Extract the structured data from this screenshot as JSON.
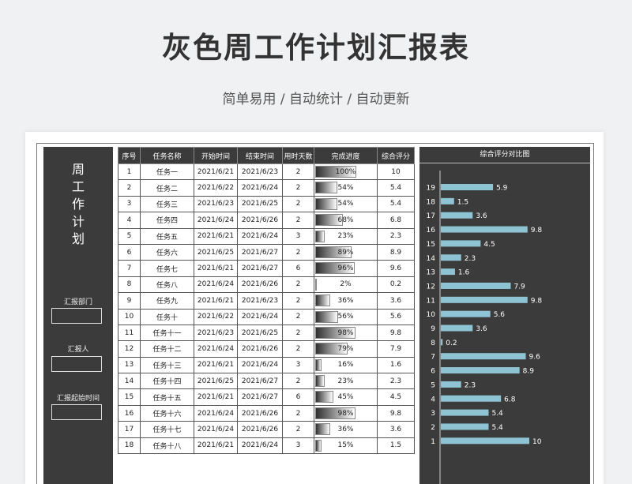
{
  "header": {
    "title": "灰色周工作计划汇报表",
    "subtitle": "简单易用 / 自动统计 / 自动更新"
  },
  "sidebar": {
    "vertical_title": [
      "周",
      "工",
      "作",
      "计",
      "划"
    ],
    "fields": [
      {
        "label": "汇报部门",
        "value": ""
      },
      {
        "label": "汇报人",
        "value": ""
      },
      {
        "label": "汇报起始时间",
        "value": ""
      }
    ]
  },
  "table": {
    "columns": [
      "序号",
      "任务名称",
      "开始时间",
      "结束时间",
      "用时天数",
      "完成进度",
      "综合评分"
    ],
    "rows": [
      [
        "1",
        "任务一",
        "2021/6/21",
        "2021/6/23",
        "2",
        "100%",
        "10"
      ],
      [
        "2",
        "任务二",
        "2021/6/22",
        "2021/6/24",
        "2",
        "54%",
        "5.4"
      ],
      [
        "3",
        "任务三",
        "2021/6/23",
        "2021/6/25",
        "2",
        "54%",
        "5.4"
      ],
      [
        "4",
        "任务四",
        "2021/6/24",
        "2021/6/26",
        "2",
        "68%",
        "6.8"
      ],
      [
        "5",
        "任务五",
        "2021/6/21",
        "2021/6/24",
        "3",
        "23%",
        "2.3"
      ],
      [
        "6",
        "任务六",
        "2021/6/25",
        "2021/6/27",
        "2",
        "89%",
        "8.9"
      ],
      [
        "7",
        "任务七",
        "2021/6/21",
        "2021/6/27",
        "6",
        "96%",
        "9.6"
      ],
      [
        "8",
        "任务八",
        "2021/6/24",
        "2021/6/26",
        "2",
        "2%",
        "0.2"
      ],
      [
        "9",
        "任务九",
        "2021/6/21",
        "2021/6/23",
        "2",
        "36%",
        "3.6"
      ],
      [
        "10",
        "任务十",
        "2021/6/22",
        "2021/6/24",
        "2",
        "56%",
        "5.6"
      ],
      [
        "11",
        "任务十一",
        "2021/6/23",
        "2021/6/25",
        "2",
        "98%",
        "9.8"
      ],
      [
        "12",
        "任务十二",
        "2021/6/24",
        "2021/6/26",
        "2",
        "79%",
        "7.9"
      ],
      [
        "13",
        "任务十三",
        "2021/6/21",
        "2021/6/24",
        "3",
        "16%",
        "1.6"
      ],
      [
        "14",
        "任务十四",
        "2021/6/25",
        "2021/6/27",
        "2",
        "23%",
        "2.3"
      ],
      [
        "15",
        "任务十五",
        "2021/6/21",
        "2021/6/27",
        "6",
        "45%",
        "4.5"
      ],
      [
        "16",
        "任务十六",
        "2021/6/24",
        "2021/6/26",
        "2",
        "98%",
        "9.8"
      ],
      [
        "17",
        "任务十七",
        "2021/6/24",
        "2021/6/26",
        "2",
        "36%",
        "3.6"
      ],
      [
        "18",
        "任务十八",
        "2021/6/21",
        "2021/6/24",
        "3",
        "15%",
        "1.5"
      ]
    ],
    "progress_fraction": [
      1.0,
      0.54,
      0.54,
      0.68,
      0.23,
      0.89,
      0.96,
      0.02,
      0.36,
      0.56,
      0.98,
      0.79,
      0.16,
      0.23,
      0.45,
      0.98,
      0.36,
      0.15
    ]
  },
  "chart_data": {
    "type": "bar",
    "orientation": "horizontal",
    "title": "综合评分对比图",
    "categories": [
      "1",
      "2",
      "3",
      "4",
      "5",
      "6",
      "7",
      "8",
      "9",
      "10",
      "11",
      "12",
      "13",
      "14",
      "15",
      "16",
      "17",
      "18",
      "19"
    ],
    "values": [
      10,
      5.4,
      5.4,
      6.8,
      2.3,
      8.9,
      9.6,
      0.2,
      3.6,
      5.6,
      9.8,
      7.9,
      1.6,
      2.3,
      4.5,
      9.8,
      3.6,
      1.5,
      5.9
    ],
    "xlim": [
      0,
      10
    ],
    "category_order": "bottom-to-top",
    "grid": false,
    "bar_color": "#8ec3d3"
  },
  "colors": {
    "dark_panel": "#3b3b3b",
    "page_bg": "#f0f1f2",
    "bar": "#8ec3d3"
  }
}
